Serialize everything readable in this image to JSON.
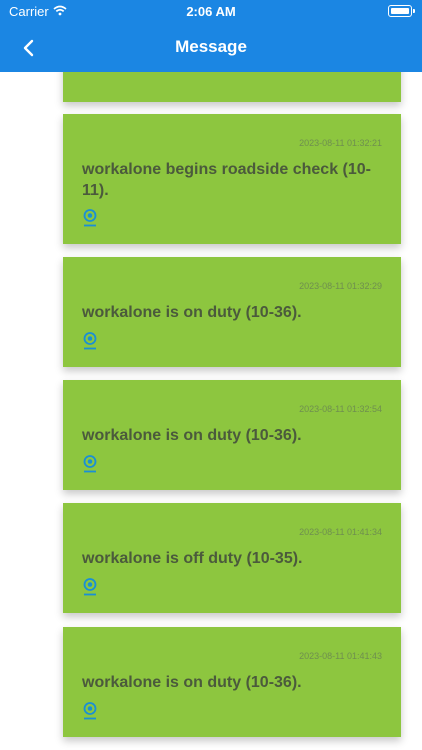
{
  "status": {
    "carrier": "Carrier",
    "time": "2:06 AM"
  },
  "nav": {
    "title": "Message"
  },
  "messages": [
    {
      "time": "2023-08-11 01:32:21",
      "text": "workalone begins roadside check (10-11)."
    },
    {
      "time": "2023-08-11 01:32:29",
      "text": "workalone is on duty (10-36)."
    },
    {
      "time": "2023-08-11 01:32:54",
      "text": "workalone is on duty (10-36)."
    },
    {
      "time": "2023-08-11 01:41:34",
      "text": "workalone is off duty (10-35)."
    },
    {
      "time": "2023-08-11 01:41:43",
      "text": "workalone is on duty (10-36)."
    }
  ],
  "colors": {
    "accent": "#1b86e3",
    "card": "#8dc63f",
    "icon": "#1a8fd6"
  }
}
